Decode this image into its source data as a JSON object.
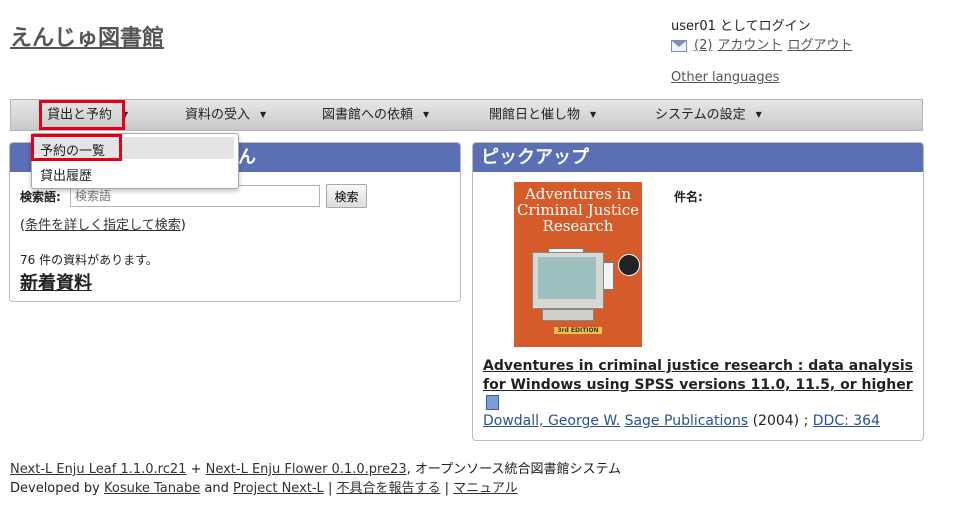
{
  "site": {
    "title": "えんじゅ図書館"
  },
  "user_box": {
    "login_text": "user01 としてログイン",
    "messages_link": "(2)",
    "account_link": "アカウント",
    "logout_link": "ログアウト",
    "other_languages": "Other languages"
  },
  "menu": {
    "items": [
      {
        "label": "貸出と予約"
      },
      {
        "label": "資料の受入"
      },
      {
        "label": "図書館への依頼"
      },
      {
        "label": "開館日と催し物"
      },
      {
        "label": "システムの設定"
      }
    ],
    "dropdown": [
      {
        "label": "予約の一覧"
      },
      {
        "label": "貸出履歴"
      }
    ]
  },
  "left_panel": {
    "header_visible": "ん",
    "search_label": "検索語:",
    "search_placeholder": "検索語",
    "search_button": "検索",
    "adv_open": "(",
    "adv_link": "条件を詳しく指定して検索",
    "adv_close": ")",
    "count_text": "76 件の資料があります。",
    "new_materials": "新着資料"
  },
  "right_panel": {
    "header": "ピックアップ",
    "field_label": "件名:",
    "cover": {
      "title": "Adventures in Criminal Justice Research",
      "edition": "3rd EDITION"
    },
    "book_title": "Adventures in criminal justice research : data analysis for Windows using SPSS versions 11.0, 11.5, or higher",
    "author": "Dowdall, George W.",
    "publisher": "Sage Publications",
    "year_text": "(2004) ;",
    "ddc": "DDC: 364"
  },
  "footer": {
    "leaf": "Next-L Enju Leaf 1.1.0.rc21",
    "plus": " + ",
    "flower": "Next-L Enju Flower 0.1.0.pre23",
    "system_text": ", オープンソース統合図書館システム",
    "developed_by": "Developed by ",
    "kosuke": "Kosuke Tanabe",
    "and": " and ",
    "project": "Project Next-L",
    "sep1": " | ",
    "report": "不具合を報告する",
    "sep2": " | ",
    "manual": "マニュアル"
  },
  "colors": {
    "panel_header": "#5b6fb5",
    "highlight_box": "#e0001a",
    "cover": "#d65b2a"
  }
}
